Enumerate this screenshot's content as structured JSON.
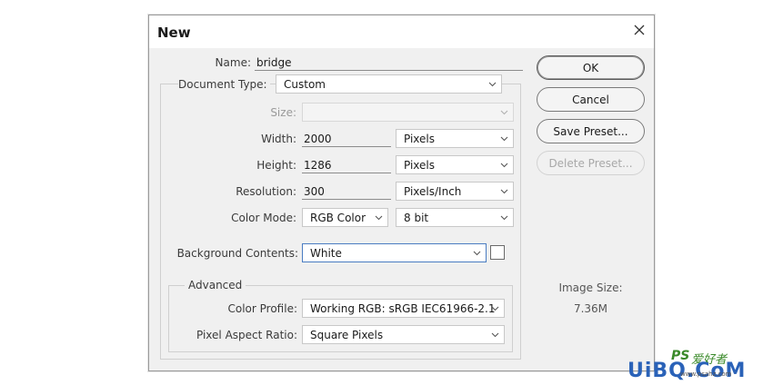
{
  "dialog": {
    "title": "New",
    "close_icon": "close-icon"
  },
  "form": {
    "name": {
      "label": "Name:",
      "value": "bridge"
    },
    "document_type": {
      "label": "Document Type:",
      "value": "Custom"
    },
    "size": {
      "label": "Size:",
      "value": ""
    },
    "width": {
      "label": "Width:",
      "value": "2000",
      "unit": "Pixels"
    },
    "height": {
      "label": "Height:",
      "value": "1286",
      "unit": "Pixels"
    },
    "resolution": {
      "label": "Resolution:",
      "value": "300",
      "unit": "Pixels/Inch"
    },
    "color_mode": {
      "label": "Color Mode:",
      "value": "RGB Color",
      "bit_depth": "8 bit"
    },
    "background_contents": {
      "label": "Background Contents:",
      "value": "White",
      "swatch_color": "#ffffff"
    }
  },
  "advanced": {
    "title": "Advanced",
    "color_profile": {
      "label": "Color Profile:",
      "value": "Working RGB:  sRGB IEC61966-2.1"
    },
    "pixel_aspect_ratio": {
      "label": "Pixel Aspect Ratio:",
      "value": "Square Pixels"
    }
  },
  "buttons": {
    "ok": "OK",
    "cancel": "Cancel",
    "save_preset": "Save Preset...",
    "delete_preset": "Delete Preset..."
  },
  "image_size": {
    "label": "Image Size:",
    "value": "7.36M"
  },
  "watermark": {
    "ps_text": "PS",
    "cn_text": "爱好者",
    "brand": "UiBQ.CoM",
    "small_url": "www.psahz.com"
  },
  "colors": {
    "dialog_bg": "#f0f0f0",
    "focus_border": "#4a7cc2",
    "watermark_green": "#3a8a2a",
    "watermark_blue": "#2a62b8"
  }
}
